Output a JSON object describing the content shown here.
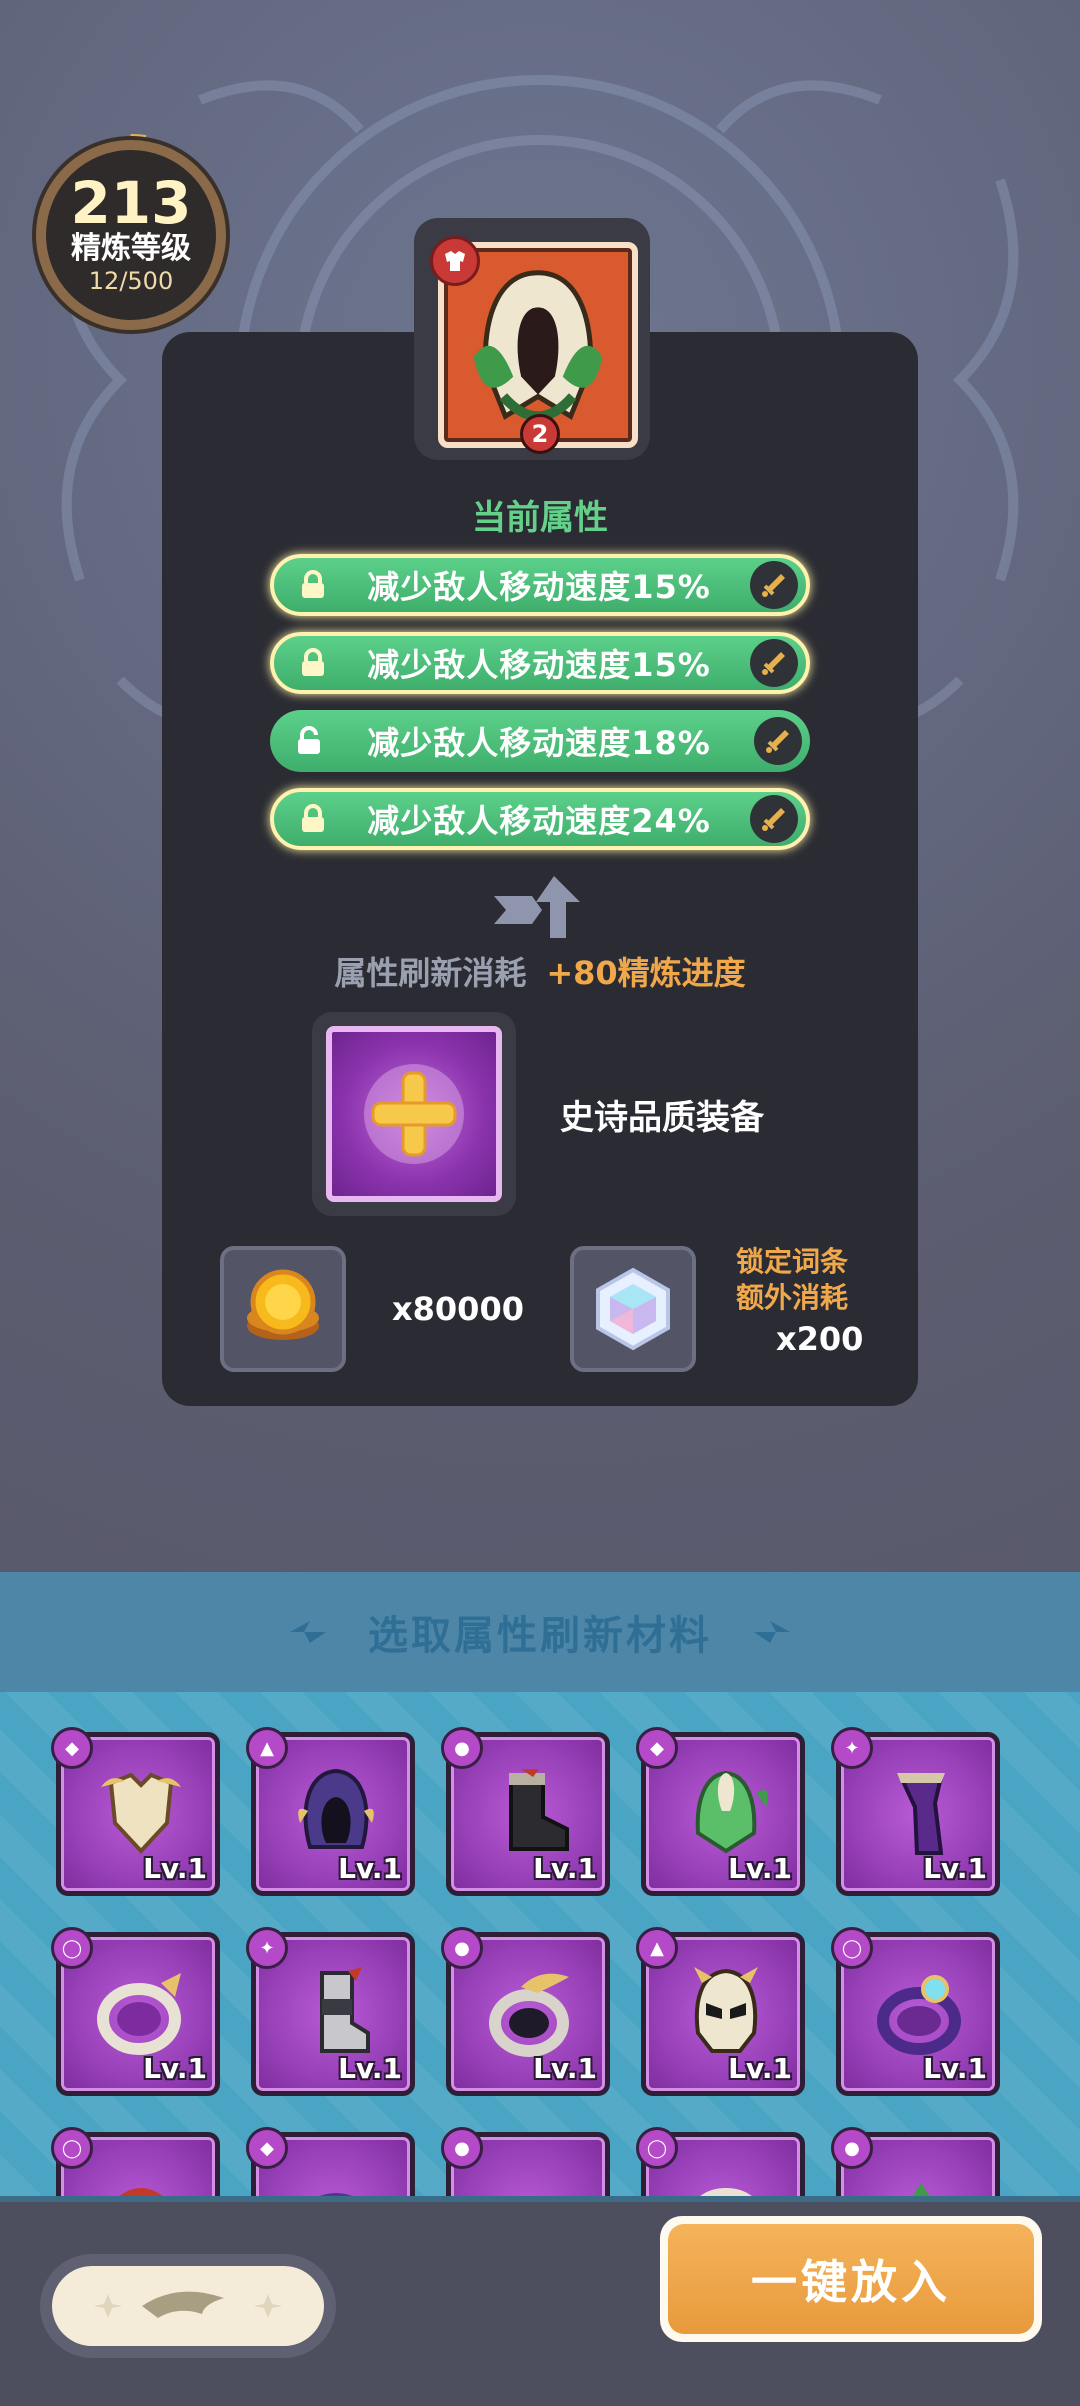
{
  "level": {
    "value": "213",
    "label": "精炼等级",
    "progress": "12/500"
  },
  "current_attrs": {
    "title": "当前属性",
    "items": [
      {
        "text": "减少敌人移动速度15%",
        "locked": true
      },
      {
        "text": "减少敌人移动速度15%",
        "locked": true
      },
      {
        "text": "减少敌人移动速度18%",
        "locked": false
      },
      {
        "text": "减少敌人移动速度24%",
        "locked": true
      }
    ]
  },
  "equipped_item": {
    "count": "2",
    "type_icon": "armor-icon"
  },
  "refresh": {
    "cost_label": "属性刷新消耗",
    "bonus": "+80精炼进度"
  },
  "material_slot": {
    "label": "史诗品质装备"
  },
  "costs": {
    "gold_amount": "x80000",
    "lock_label_line1": "锁定词条",
    "lock_label_line2": "额外消耗",
    "lock_amount": "x200"
  },
  "selector": {
    "title": "选取属性刷新材料",
    "tiles": [
      {
        "type": "armor",
        "level": "Lv.1",
        "art": "chestplate"
      },
      {
        "type": "helmet",
        "level": "Lv.1",
        "art": "hood"
      },
      {
        "type": "boots",
        "level": "Lv.1",
        "art": "boot"
      },
      {
        "type": "armor",
        "level": "Lv.1",
        "art": "cloak"
      },
      {
        "type": "cape",
        "level": "Lv.1",
        "art": "scarf"
      },
      {
        "type": "ring",
        "level": "Lv.1",
        "art": "ring"
      },
      {
        "type": "cape",
        "level": "Lv.1",
        "art": "greave"
      },
      {
        "type": "boots",
        "level": "Lv.1",
        "art": "ring2"
      },
      {
        "type": "helmet",
        "level": "Lv.1",
        "art": "helmet"
      },
      {
        "type": "ring",
        "level": "Lv.1",
        "art": "ring3"
      },
      {
        "type": "ring",
        "level": "",
        "art": "partial"
      },
      {
        "type": "armor",
        "level": "",
        "art": "partial"
      },
      {
        "type": "boots",
        "level": "",
        "art": "partial"
      },
      {
        "type": "ring",
        "level": "",
        "art": "partial"
      },
      {
        "type": "boots",
        "level": "",
        "art": "partial"
      }
    ]
  },
  "buttons": {
    "put_all": "一键放入",
    "filter_icon": "filter-icon"
  },
  "colors": {
    "accent_green": "#5cd08a",
    "accent_orange": "#f0a84a",
    "epic_purple": "#9740b8"
  }
}
